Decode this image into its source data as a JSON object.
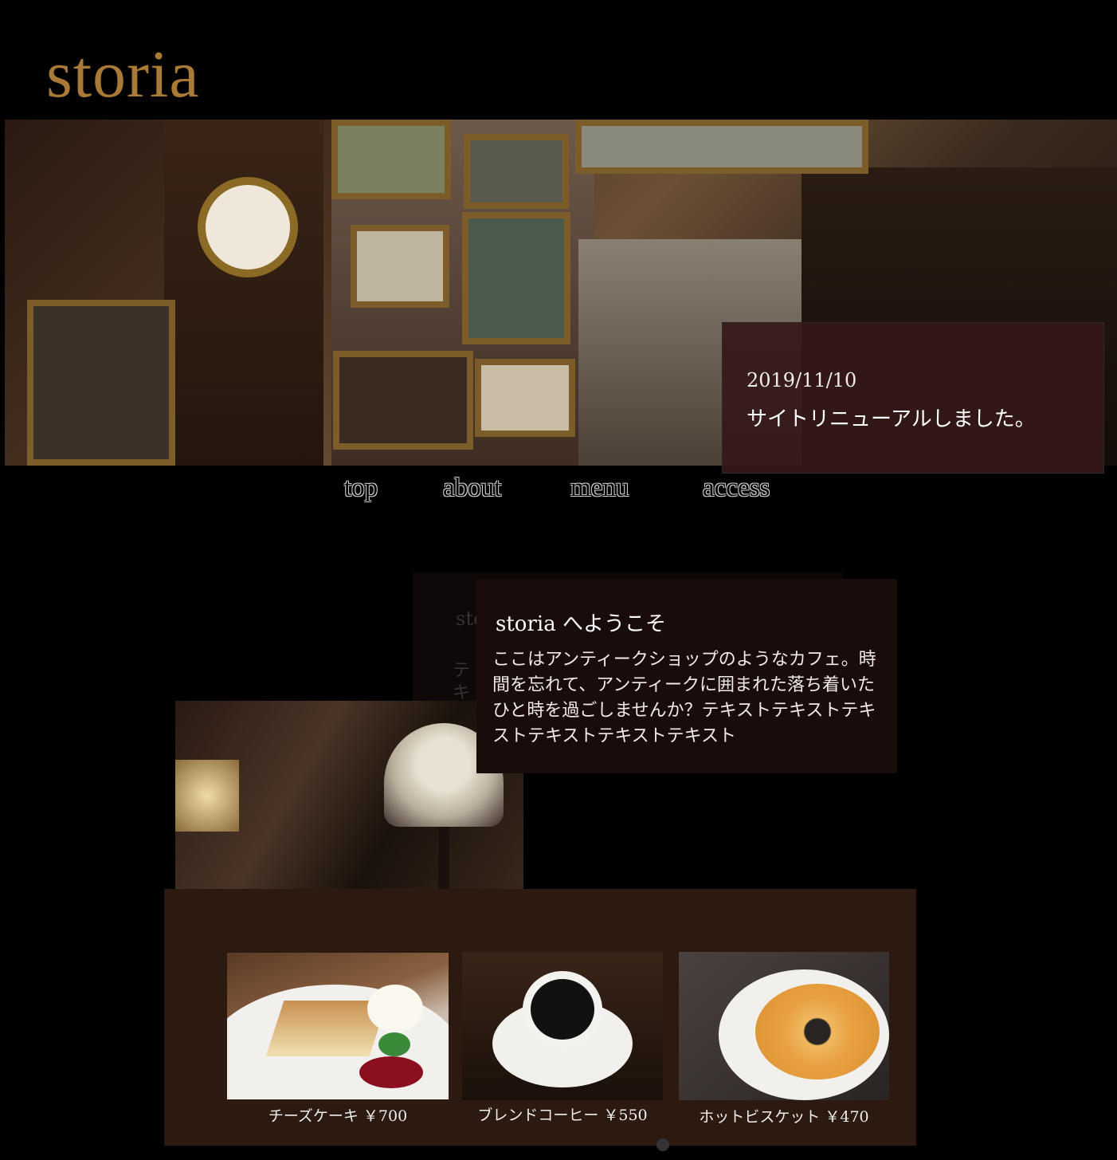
{
  "header": {
    "logo": "storia"
  },
  "news": {
    "date": "2019/11/10",
    "message": "サイトリニューアルしました。"
  },
  "nav": {
    "items": [
      "top",
      "about",
      "menu",
      "access"
    ]
  },
  "intro_back": {
    "title": "sto",
    "text": "テキスト"
  },
  "welcome": {
    "title": "storia へようこそ",
    "body": "ここはアンティークショップのようなカフェ。時間を忘れて、アンティークに囲まれた落ち着いたひと時を過ごしませんか？テキストテキストテキストテキストテキストテキスト"
  },
  "menu": {
    "items": [
      {
        "name": "チーズケーキ ￥700"
      },
      {
        "name": "ブレンドコーヒー ￥550"
      },
      {
        "name": "ホットビスケット ￥470"
      }
    ]
  },
  "colors": {
    "logo": "#a87a36",
    "news_bg": "#341818",
    "welcome_bg": "#1a0c0a",
    "menu_bg": "#2c1a10"
  }
}
